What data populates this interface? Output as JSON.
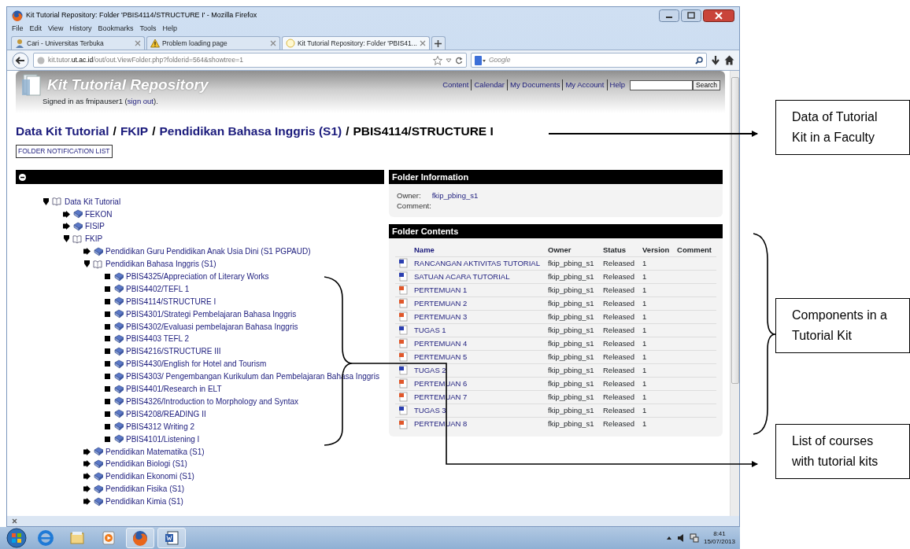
{
  "window": {
    "title": "Kit Tutorial Repository: Folder 'PBIS4114/STRUCTURE I' - Mozilla Firefox"
  },
  "menu": [
    "File",
    "Edit",
    "View",
    "History",
    "Bookmarks",
    "Tools",
    "Help"
  ],
  "tabs": [
    {
      "label": "Cari - Universitas Terbuka",
      "kind": "person",
      "selected": false
    },
    {
      "label": "Problem loading page",
      "kind": "warning",
      "selected": false
    },
    {
      "label": "Kit Tutorial Repository: Folder 'PBIS41...",
      "kind": "site",
      "selected": true
    }
  ],
  "address": {
    "prefix": "kit.tutor.",
    "domain": "ut.ac.id",
    "rest": "/out/out.ViewFolder.php?folderid=564&showtree=1"
  },
  "search": {
    "placeholder": "Google"
  },
  "site": {
    "title": "Kit Tutorial Repository",
    "nav": [
      "Content",
      "Calendar",
      "My Documents",
      "My Account",
      "Help"
    ],
    "search_button": "Search",
    "signed_in": {
      "prefix": "Signed in as fmipauser1 (",
      "link": "sign out",
      "suffix": ")."
    }
  },
  "breadcrumb": [
    {
      "text": "Data Kit Tutorial",
      "kind": "link"
    },
    {
      "text": "/",
      "kind": "separator"
    },
    {
      "text": "FKIP",
      "kind": "link"
    },
    {
      "text": "/",
      "kind": "separator"
    },
    {
      "text": "Pendidikan Bahasa Inggris (S1)",
      "kind": "link"
    },
    {
      "text": "/",
      "kind": "separator"
    },
    {
      "text": "PBIS4114/STRUCTURE I",
      "kind": "current"
    }
  ],
  "notification_button": "FOLDER NOTIFICATION LIST",
  "tree": [
    {
      "label": "Data Kit Tutorial",
      "kind": "folder",
      "expanded": true,
      "children": [
        {
          "label": "FEKON",
          "kind": "folder",
          "expanded": false
        },
        {
          "label": "FISIP",
          "kind": "folder",
          "expanded": false
        },
        {
          "label": "FKIP",
          "kind": "folder",
          "expanded": true,
          "children": [
            {
              "label": "Pendidikan Guru Pendidikan Anak Usia Dini (S1 PGPAUD)",
              "kind": "folder",
              "expanded": false
            },
            {
              "label": "Pendidikan Bahasa Inggris (S1)",
              "kind": "folder",
              "expanded": true,
              "children": [
                {
                  "label": "PBIS4325/Appreciation of Literary Works",
                  "kind": "leaf"
                },
                {
                  "label": "PBIS4402/TEFL 1",
                  "kind": "leaf"
                },
                {
                  "label": "PBIS4114/STRUCTURE I",
                  "kind": "leaf"
                },
                {
                  "label": "PBIS4301/Strategi Pembelajaran Bahasa Inggris",
                  "kind": "leaf"
                },
                {
                  "label": "PBIS4302/Evaluasi pembelajaran Bahasa Inggris",
                  "kind": "leaf"
                },
                {
                  "label": "PBIS4403 TEFL 2",
                  "kind": "leaf"
                },
                {
                  "label": "PBIS4216/STRUCTURE III",
                  "kind": "leaf"
                },
                {
                  "label": "PBIS4430/English for Hotel and Tourism",
                  "kind": "leaf"
                },
                {
                  "label": "PBIS4303/ Pengembangan Kurikulum dan Pembelajaran Bahasa Inggris",
                  "kind": "leaf"
                },
                {
                  "label": "PBIS4401/Research in ELT",
                  "kind": "leaf"
                },
                {
                  "label": "PBIS4326/Introduction to Morphology and Syntax",
                  "kind": "leaf"
                },
                {
                  "label": "PBIS4208/READING II",
                  "kind": "leaf"
                },
                {
                  "label": "PBIS4312 Writing 2",
                  "kind": "leaf"
                },
                {
                  "label": "PBIS4101/Listening I",
                  "kind": "leaf"
                }
              ]
            },
            {
              "label": "Pendidikan Matematika (S1)",
              "kind": "folder",
              "expanded": false
            },
            {
              "label": "Pendidikan Biologi (S1)",
              "kind": "folder",
              "expanded": false
            },
            {
              "label": "Pendidikan Ekonomi (S1)",
              "kind": "folder",
              "expanded": false
            },
            {
              "label": "Pendidikan Fisika (S1)",
              "kind": "folder",
              "expanded": false
            },
            {
              "label": "Pendidikan Kimia (S1)",
              "kind": "folder",
              "expanded": false
            }
          ]
        }
      ]
    }
  ],
  "folder_info": {
    "title": "Folder Information",
    "fields": [
      {
        "label": "Owner:",
        "value": "fkip_pbing_s1"
      },
      {
        "label": "Comment:"
      }
    ]
  },
  "folder_contents": {
    "title": "Folder Contents",
    "columns": [
      "Name",
      "Owner",
      "Status",
      "Version",
      "Comment"
    ],
    "rows": [
      {
        "kind": "doc",
        "name": "RANCANGAN AKTIVITAS TUTORIAL",
        "owner": "fkip_pbing_s1",
        "status": "Released",
        "version": "1"
      },
      {
        "kind": "doc",
        "name": "SATUAN ACARA TUTORIAL",
        "owner": "fkip_pbing_s1",
        "status": "Released",
        "version": "1"
      },
      {
        "kind": "slides",
        "name": "PERTEMUAN 1",
        "owner": "fkip_pbing_s1",
        "status": "Released",
        "version": "1"
      },
      {
        "kind": "slides",
        "name": "PERTEMUAN 2",
        "owner": "fkip_pbing_s1",
        "status": "Released",
        "version": "1"
      },
      {
        "kind": "slides",
        "name": "PERTEMUAN 3",
        "owner": "fkip_pbing_s1",
        "status": "Released",
        "version": "1"
      },
      {
        "kind": "doc",
        "name": "TUGAS 1",
        "owner": "fkip_pbing_s1",
        "status": "Released",
        "version": "1"
      },
      {
        "kind": "slides",
        "name": "PERTEMUAN 4",
        "owner": "fkip_pbing_s1",
        "status": "Released",
        "version": "1"
      },
      {
        "kind": "slides",
        "name": "PERTEMUAN 5",
        "owner": "fkip_pbing_s1",
        "status": "Released",
        "version": "1"
      },
      {
        "kind": "doc",
        "name": "TUGAS 2",
        "owner": "fkip_pbing_s1",
        "status": "Released",
        "version": "1"
      },
      {
        "kind": "slides",
        "name": "PERTEMUAN 6",
        "owner": "fkip_pbing_s1",
        "status": "Released",
        "version": "1"
      },
      {
        "kind": "slides",
        "name": "PERTEMUAN 7",
        "owner": "fkip_pbing_s1",
        "status": "Released",
        "version": "1"
      },
      {
        "kind": "doc",
        "name": "TUGAS 3",
        "owner": "fkip_pbing_s1",
        "status": "Released",
        "version": "1"
      },
      {
        "kind": "slides",
        "name": "PERTEMUAN 8",
        "owner": "fkip_pbing_s1",
        "status": "Released",
        "version": "1"
      }
    ]
  },
  "taskbar": {
    "apps": [
      {
        "kind": "ie",
        "running": false
      },
      {
        "kind": "explorer",
        "running": false
      },
      {
        "kind": "media",
        "running": false
      },
      {
        "kind": "firefox",
        "running": true
      },
      {
        "kind": "word",
        "running": true
      }
    ],
    "time": "8:41",
    "date": "15/07/2013"
  },
  "annotations": [
    "Data of Tutorial Kit in a Faculty",
    "Components in a Tutorial Kit",
    "List of courses with tutorial kits"
  ]
}
